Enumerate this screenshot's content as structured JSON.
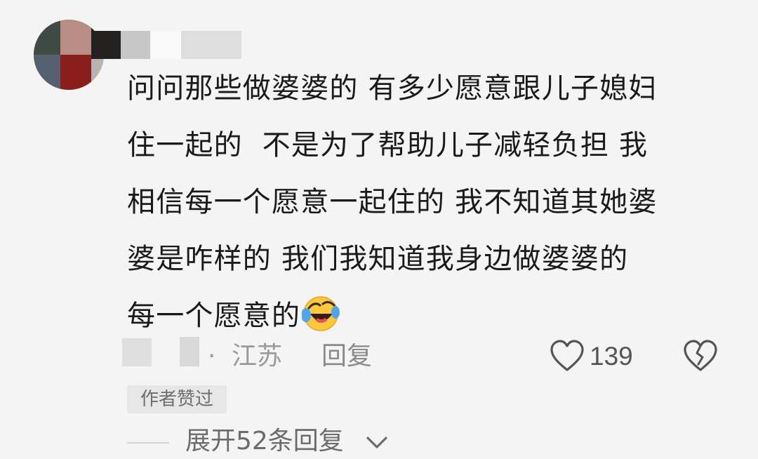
{
  "comment": {
    "lines": [
      "问问那些做婆婆的 有多少愿意跟儿子媳妇",
      "住一起的  不是为了帮助儿子减轻负担 我",
      "相信每一个愿意一起住的 我不知道其她婆",
      "婆是咋样的 我们我知道我身边做婆婆的",
      "每一个愿意的"
    ],
    "emoji": "face-with-tears-of-joy-icon"
  },
  "meta": {
    "separator": "·",
    "location": "江苏",
    "reply_label": "回复"
  },
  "likes": {
    "count": "139"
  },
  "badge": {
    "label": "作者赞过"
  },
  "expand": {
    "label": "展开52条回复"
  },
  "colors": {
    "background": "#f4f4f4",
    "text": "#1a1a1a",
    "muted": "#9a9a9a"
  }
}
